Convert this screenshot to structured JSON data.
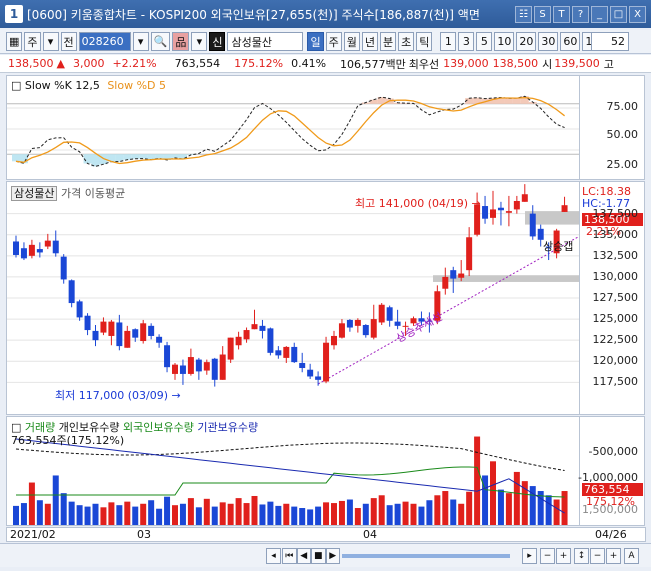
{
  "window": {
    "title": "[0600] 키움종합차트 - KOSPI200 외국인보유[27,655(천)] 주식수[186,887(천)] 액면",
    "buttons": [
      "☷",
      "S",
      "T",
      "?",
      "_",
      "□",
      "X"
    ]
  },
  "toolbar": {
    "period_toggle": "주",
    "scope_btn": "전",
    "stock_code": "028260",
    "stock_name": "삼성물산",
    "credit_badge": "신",
    "periods": [
      "일",
      "주",
      "월",
      "년",
      "분",
      "초",
      "틱"
    ],
    "numbers": [
      "1",
      "3",
      "5",
      "10",
      "20",
      "30",
      "60",
      "120"
    ],
    "count": "52"
  },
  "quote": {
    "price": "138,500",
    "change": "3,000",
    "change_pct": "+2.21%",
    "volume": "763,554",
    "vol_ratio": "175.12%",
    "turnover": "0.41%",
    "amount": "106,577백만",
    "best_ask_label": "최우선",
    "best_ask": "139,000",
    "best_bid": "138,500",
    "open_label": "시",
    "open": "139,500",
    "high_label": "고"
  },
  "stochastic": {
    "title_k": "Slow %K 12,5",
    "title_d": "Slow %D 5",
    "ticks": [
      "75.00",
      "50.00",
      "25.00"
    ]
  },
  "price_panel": {
    "name_tag": "삼성물산",
    "ma_label": "가격 이동평균",
    "high_note": "최고 141,000 (04/19) →",
    "low_note": "최저 117,000 (03/09) →",
    "trend_label": "상승추세선",
    "gap_label": "상승갭",
    "lc": "LC:18.38",
    "hc": "HC:-1.77",
    "cur_price": "138,500",
    "cur_pct": "2.21%",
    "ticks": [
      "137,500",
      "135,000",
      "132,500",
      "130,000",
      "127,500",
      "125,000",
      "122,500",
      "120,000",
      "117,500"
    ],
    "candles": [
      [
        134200,
        132600,
        134900,
        132300
      ],
      [
        133400,
        132200,
        134100,
        132000
      ],
      [
        132500,
        133800,
        134400,
        132200
      ],
      [
        133300,
        132900,
        134100,
        132300
      ],
      [
        133600,
        134300,
        135100,
        133300
      ],
      [
        134300,
        132800,
        135500,
        132400
      ],
      [
        132400,
        129700,
        132700,
        129200
      ],
      [
        129600,
        126900,
        129700,
        126400
      ],
      [
        127100,
        125200,
        127300,
        124800
      ],
      [
        125400,
        123700,
        125700,
        123100
      ],
      [
        123600,
        122500,
        124300,
        121800
      ],
      [
        123400,
        124700,
        125200,
        123100
      ],
      [
        123000,
        124700,
        124900,
        121900
      ],
      [
        124600,
        121800,
        125500,
        121300
      ],
      [
        121600,
        123600,
        124200,
        121600
      ],
      [
        123800,
        122800,
        123900,
        122300
      ],
      [
        122400,
        124500,
        124900,
        122100
      ],
      [
        124200,
        123000,
        124500,
        122600
      ],
      [
        122900,
        122200,
        123200,
        121600
      ],
      [
        121900,
        119300,
        122300,
        118700
      ],
      [
        118500,
        119600,
        119800,
        117800
      ],
      [
        119500,
        118500,
        120200,
        117200
      ],
      [
        118500,
        120500,
        121500,
        118300
      ],
      [
        120200,
        118800,
        120400,
        117800
      ],
      [
        118900,
        119900,
        120200,
        118400
      ],
      [
        120300,
        117800,
        120400,
        117000
      ],
      [
        117800,
        120800,
        121800,
        117800
      ],
      [
        120200,
        122800,
        122800,
        119800
      ],
      [
        121900,
        122900,
        123500,
        121400
      ],
      [
        122600,
        123700,
        124000,
        122200
      ],
      [
        123800,
        124400,
        126100,
        123800
      ],
      [
        124200,
        123600,
        124900,
        122700
      ],
      [
        123900,
        121000,
        124000,
        120700
      ],
      [
        121300,
        120700,
        121800,
        120300
      ],
      [
        120400,
        121700,
        121800,
        119800
      ],
      [
        121700,
        119900,
        122200,
        119800
      ],
      [
        119800,
        119200,
        121000,
        118700
      ],
      [
        119000,
        118200,
        119700,
        117900
      ],
      [
        118200,
        117800,
        118800,
        117100
      ],
      [
        117600,
        122200,
        122900,
        117400
      ],
      [
        121900,
        123000,
        123600,
        121400
      ],
      [
        122800,
        124500,
        125000,
        122700
      ],
      [
        124900,
        124000,
        125000,
        123500
      ],
      [
        124200,
        124900,
        125100,
        123400
      ],
      [
        124300,
        123100,
        124400,
        122800
      ],
      [
        122800,
        125000,
        126700,
        122600
      ],
      [
        124600,
        126700,
        126900,
        124300
      ],
      [
        126400,
        124800,
        126600,
        124100
      ],
      [
        124700,
        124200,
        126100,
        123800
      ],
      [
        124200,
        124200,
        124700,
        123000
      ],
      [
        124500,
        125100,
        125300,
        124200
      ],
      [
        125100,
        124700,
        125900,
        124300
      ],
      [
        124800,
        124700,
        125800,
        123400
      ],
      [
        124800,
        128300,
        129000,
        124400
      ],
      [
        128600,
        130000,
        131100,
        127900
      ],
      [
        130800,
        129800,
        131200,
        128100
      ],
      [
        129900,
        130400,
        132000,
        129500
      ],
      [
        130800,
        134700,
        135900,
        130100
      ],
      [
        135000,
        138600,
        140000,
        134800
      ],
      [
        138400,
        136900,
        139600,
        136300
      ],
      [
        137000,
        138000,
        140200,
        136200
      ],
      [
        138200,
        137900,
        138900,
        136100
      ],
      [
        137600,
        137800,
        139600,
        136000
      ],
      [
        138000,
        139000,
        139600,
        137500
      ],
      [
        138900,
        139800,
        141000,
        138900
      ],
      [
        137500,
        134800,
        138500,
        134400
      ],
      [
        135700,
        134400,
        136200,
        133600
      ],
      [
        133600,
        133500,
        134100,
        132000
      ],
      [
        132800,
        135500,
        135700,
        132200
      ],
      [
        137700,
        138500,
        139500,
        137700
      ]
    ]
  },
  "volume_panel": {
    "legend": [
      "거래량",
      "개인보유수량",
      "외국인보유수량",
      "기관보유수량"
    ],
    "vol_label": "763,554주(175.12%)",
    "ticks": [
      "-500,000",
      "-1,000,000",
      "1,500,000"
    ],
    "cur_vol": "763,554",
    "cur_pct": "175,12%",
    "volumes": [
      270,
      310,
      600,
      350,
      300,
      700,
      450,
      330,
      280,
      260,
      300,
      250,
      320,
      280,
      330,
      260,
      300,
      350,
      230,
      400,
      280,
      300,
      380,
      250,
      370,
      260,
      320,
      300,
      380,
      310,
      410,
      290,
      330,
      270,
      300,
      260,
      240,
      220,
      260,
      320,
      310,
      340,
      360,
      240,
      300,
      380,
      420,
      280,
      300,
      330,
      300,
      260,
      350,
      420,
      480,
      360,
      300,
      470,
      1250,
      700,
      900,
      500,
      450,
      750,
      620,
      550,
      480,
      420,
      360,
      480
    ]
  },
  "xaxis": {
    "labels": [
      "2021/02",
      "03",
      "04",
      "04/26"
    ]
  },
  "colors": {
    "up": "#e0201c",
    "down": "#1a47d6",
    "k_line": "#222222",
    "d_line": "#f09a1a"
  }
}
